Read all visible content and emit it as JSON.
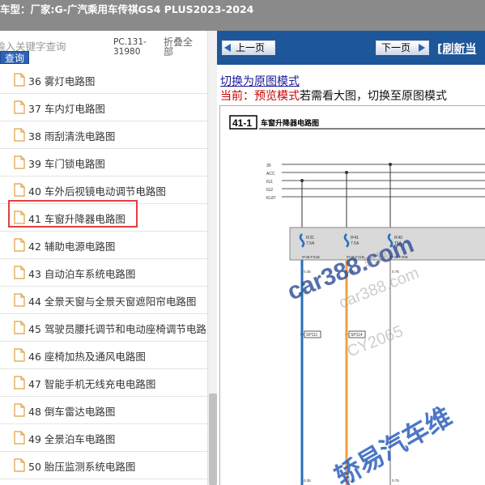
{
  "header": {
    "vehicle_prefix": "车型：",
    "vehicle_name": "厂家:G-广汽乘用车传祺GS4 PLUS2023-2024"
  },
  "search": {
    "placeholder": "输入关键字查询",
    "button_label": "查询",
    "pc_range": "PC.131-31980",
    "collapse_label": "折叠全部"
  },
  "tree": {
    "highlighted_index": 5,
    "items": [
      {
        "label": "36 雾灯电路图"
      },
      {
        "label": "37 车内灯电路图"
      },
      {
        "label": "38 雨刮清洗电路图"
      },
      {
        "label": "39 车门锁电路图"
      },
      {
        "label": "40 车外后视镜电动调节电路图"
      },
      {
        "label": "41 车窗升降器电路图"
      },
      {
        "label": "42 辅助电源电路图"
      },
      {
        "label": "43 自动泊车系统电路图"
      },
      {
        "label": "44 全景天窗与全景天窗遮阳帘电路图"
      },
      {
        "label": "45 驾驶员腰托调节和电动座椅调节电路"
      },
      {
        "label": "46 座椅加热及通风电路图"
      },
      {
        "label": "47 智能手机无线充电电路图"
      },
      {
        "label": "48 倒车雷达电路图"
      },
      {
        "label": "49 全景泊车电路图"
      },
      {
        "label": "50 胎压监测系统电路图"
      }
    ]
  },
  "nav": {
    "prev_label": "上一页",
    "next_label": "下一页",
    "refresh_label": "[刷新当"
  },
  "viewer": {
    "switch_link": "切换为原图模式",
    "mode_prefix": "当前：预览模式",
    "mode_rest": "若需看大图，切换至原图模式"
  },
  "diagram": {
    "figure_number": "41-1",
    "figure_title": "车窗升降器电路图",
    "rails": [
      "30",
      "ACC",
      "IG1",
      "IG2",
      "KL87"
    ],
    "fuses": [
      {
        "name": "IF31",
        "rating": "7.5A",
        "connector": "IPJB-F31B"
      },
      {
        "name": "IF41",
        "rating": "7.5A",
        "connector": "IPJB-F41B"
      },
      {
        "name": "IF40",
        "rating": "15A",
        "connector": "IPJB-F40B"
      }
    ],
    "splices": [
      "SP111",
      "SP114"
    ],
    "wire_labels": [
      "0.35",
      "0.35",
      "0.75",
      "0.35",
      "0.35",
      "0.75"
    ],
    "watermarks": [
      "car388.com",
      "car388.com",
      "CY2065",
      "轿易",
      "轿易汽车维"
    ]
  },
  "colors": {
    "topbar": "#8a8a8a",
    "navbar": "#1e5799",
    "highlight": "#e04040",
    "wire_blue": "#2a6fb8",
    "wire_orange": "#f0a040",
    "mode_red": "#cc0000",
    "link_blue": "#1a1a9a"
  }
}
